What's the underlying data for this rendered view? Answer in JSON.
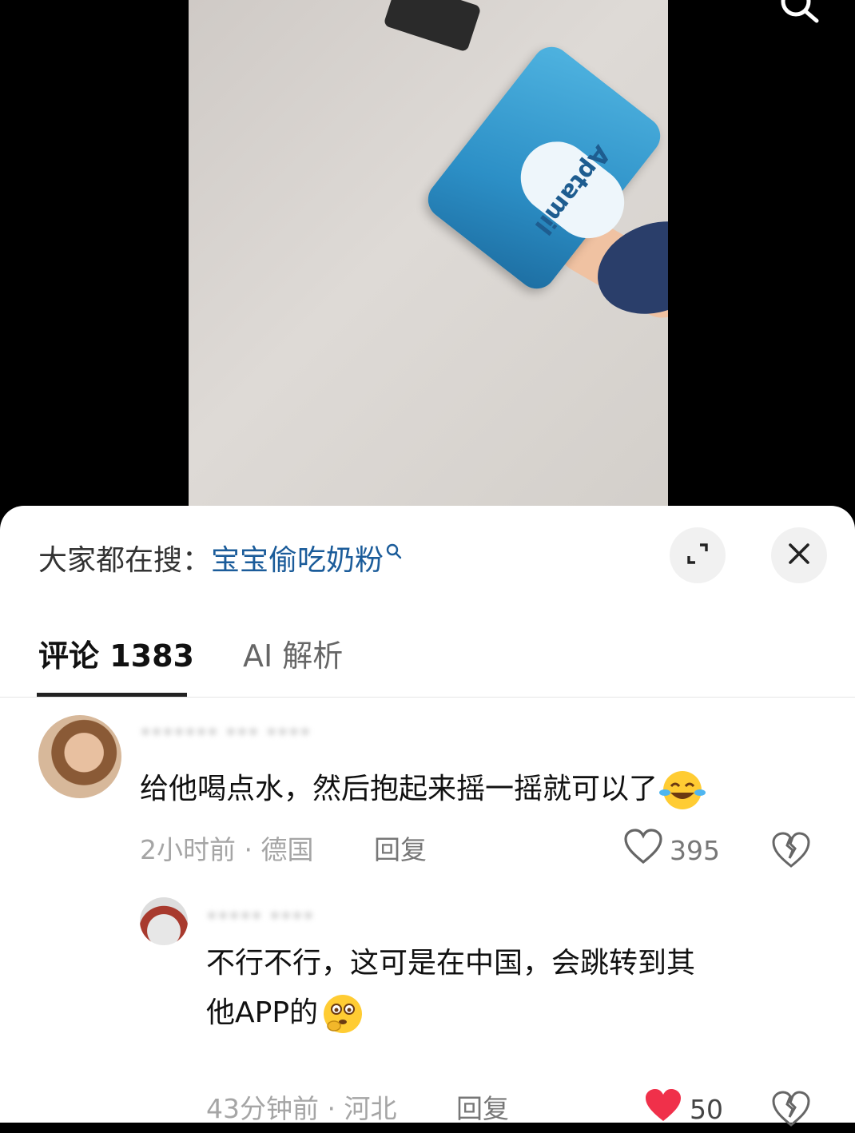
{
  "search_bar": {
    "prefix": "大家都在搜：",
    "term": "宝宝偷吃奶粉"
  },
  "video": {
    "can_brand": "Aptamil"
  },
  "tabs": [
    {
      "label": "评论 1383",
      "active": true
    },
    {
      "label": "AI 解析",
      "active": false
    }
  ],
  "comments": [
    {
      "username": "******* *** ****",
      "text": "给他喝点水，然后抱起来摇一摇就可以了",
      "emoji": "laughing-crying-emoji",
      "time": "2小时前",
      "location": "德国",
      "meta": "2小时前 · 德国",
      "reply_label": "回复",
      "likes": "395",
      "liked": false
    },
    {
      "username": "***** ****",
      "text_line1": "不行不行，这可是在中国，会跳转到其",
      "text_line2": "他APP的",
      "emoji": "thinking-worried-emoji",
      "time": "43分钟前",
      "location": "河北",
      "meta": "43分钟前 · 河北",
      "reply_label": "回复",
      "likes": "50",
      "liked": true
    }
  ],
  "colors": {
    "search_term": "#1b5c9a",
    "like_active": "#f0304a",
    "tab_active": "#111111"
  }
}
